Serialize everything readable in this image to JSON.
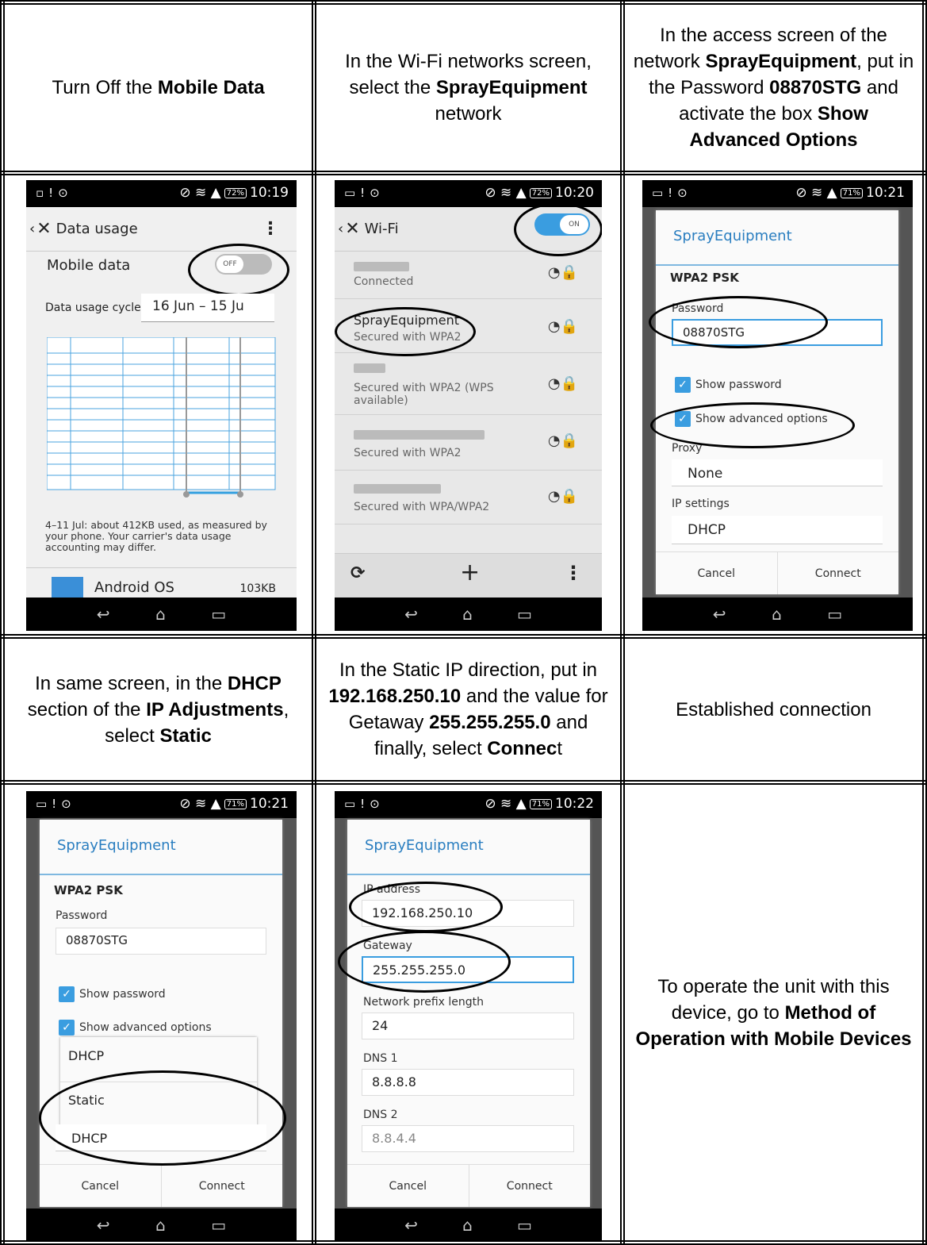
{
  "cells": {
    "r1c1": {
      "pre": "Turn Off the ",
      "b1": "Mobile Data"
    },
    "r1c2": {
      "pre": "In the Wi-Fi networks screen, select the ",
      "b1": "SprayEquipment",
      "post": " network"
    },
    "r1c3": {
      "pre": "In the access screen of the network ",
      "b1": "SprayEquipment",
      "mid": ", put in the Password ",
      "b2": "08870STG",
      "mid2": " and activate the box ",
      "b3": "Show Advanced Options"
    },
    "r3c1": {
      "pre": "In same screen, in the ",
      "b1": "DHCP",
      "mid": " section of the ",
      "b2": "IP Adjustments",
      "mid2": ", select ",
      "b3": "Static"
    },
    "r3c2": {
      "pre": "In the Static IP direction, put in ",
      "b1": "192.168.250.10",
      "mid": " and the value for Getaway ",
      "b2": "255.255.255.0",
      "mid2": " and finally, select ",
      "b3": "Connec",
      "post": "t"
    },
    "r3c3": {
      "text": "Established connection"
    },
    "r4c3": {
      "pre": "To operate the unit with this device, go to ",
      "b1": "Method of Operation with Mobile Devices"
    }
  },
  "phones": {
    "p1": {
      "time": "10:19",
      "battery": "72%",
      "title": "Data usage",
      "mobile_data": "Mobile data",
      "toggle": "OFF",
      "cycle_label": "Data usage cycle",
      "cycle_value": "16 Jun – 15 Ju",
      "note": "4–11 Jul: about 412KB used, as measured by your phone. Your carrier's data usage accounting may differ.",
      "app": "Android OS",
      "app_size": "103KB"
    },
    "p2": {
      "time": "10:20",
      "battery": "72%",
      "title": "Wi-Fi",
      "toggle": "ON",
      "networks": [
        {
          "status": "Connected"
        },
        {
          "name": "SprayEquipment",
          "status": "Secured with WPA2"
        },
        {
          "status": "Secured with WPA2 (WPS available)"
        },
        {
          "status": "Secured with WPA2"
        },
        {
          "status": "Secured with WPA/WPA2"
        }
      ],
      "plus": "+"
    },
    "p3": {
      "time": "10:21",
      "battery": "71%",
      "title": "SprayEquipment",
      "security_value": "WPA2 PSK",
      "password_label": "Password",
      "password": "08870STG",
      "show_password": "Show password",
      "show_advanced": "Show advanced options",
      "proxy_label": "Proxy",
      "proxy": "None",
      "ip_label": "IP settings",
      "ip": "DHCP",
      "cancel": "Cancel",
      "connect": "Connect"
    },
    "p4": {
      "time": "10:21",
      "battery": "71%",
      "title": "SprayEquipment",
      "security_value": "WPA2 PSK",
      "password_label": "Password",
      "password": "08870STG",
      "show_password": "Show password",
      "show_advanced": "Show advanced options",
      "options": [
        "DHCP",
        "Static"
      ],
      "ip": "DHCP",
      "cancel": "Cancel",
      "connect": "Connect"
    },
    "p5": {
      "time": "10:22",
      "battery": "71%",
      "title": "SprayEquipment",
      "ip_label": "IP address",
      "ip": "192.168.250.10",
      "gw_label": "Gateway",
      "gw": "255.255.255.0",
      "prefix_label": "Network prefix length",
      "prefix": "24",
      "dns1_label": "DNS 1",
      "dns1": "8.8.8.8",
      "dns2_label": "DNS 2",
      "dns2": "8.8.4.4",
      "cancel": "Cancel",
      "connect": "Connect"
    }
  }
}
